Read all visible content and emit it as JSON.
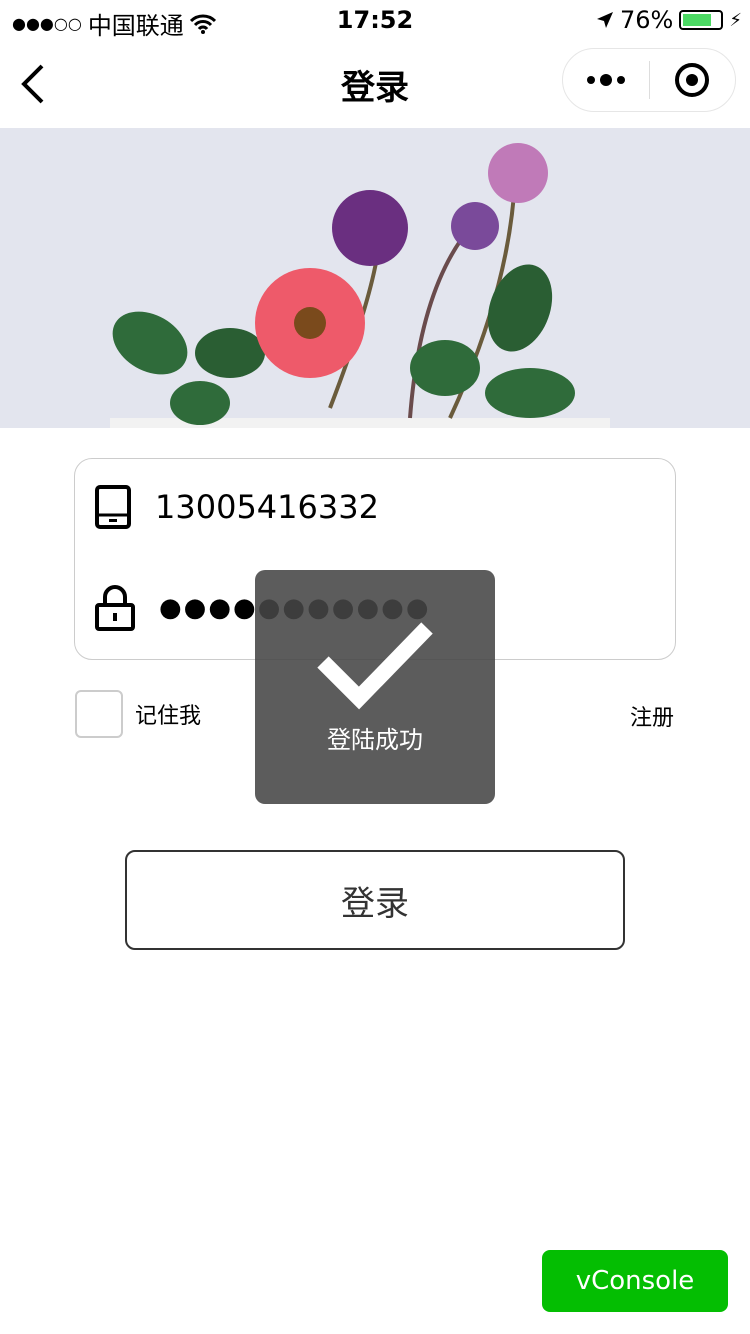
{
  "status_bar": {
    "carrier": "中国联通",
    "time": "17:52",
    "battery": "76%",
    "battery_level": 0.76,
    "signal_dots": "●●●○○"
  },
  "nav": {
    "title": "登录"
  },
  "form": {
    "phone": "13005416332",
    "password_mask": "●●●●●●●●●●●",
    "remember_label": "记住我",
    "register_label": "注册",
    "login_label": "登录"
  },
  "toast": {
    "text": "登陆成功"
  },
  "vconsole": {
    "label": "vConsole"
  },
  "colors": {
    "accent": "#04be02",
    "battery": "#4cd964"
  }
}
